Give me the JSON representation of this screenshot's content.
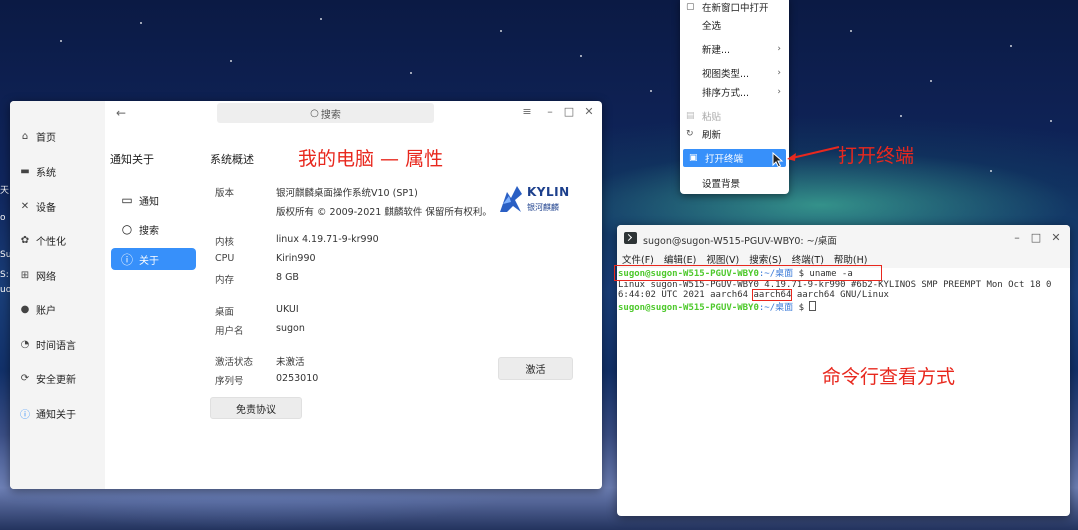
{
  "desktop": {
    "left_edge": [
      "天",
      "o",
      "Suo",
      "S:",
      "uo"
    ]
  },
  "settings": {
    "search_placeholder": "搜索",
    "sidebar": [
      {
        "icon": "home-icon",
        "label": "首页"
      },
      {
        "icon": "monitor-icon",
        "label": "系统"
      },
      {
        "icon": "tools-icon",
        "label": "设备"
      },
      {
        "icon": "palette-icon",
        "label": "个性化"
      },
      {
        "icon": "network-icon",
        "label": "网络"
      },
      {
        "icon": "user-icon",
        "label": "账户"
      },
      {
        "icon": "clock-icon",
        "label": "时间语言"
      },
      {
        "icon": "update-icon",
        "label": "安全更新"
      },
      {
        "icon": "info-icon",
        "label": "通知关于"
      }
    ],
    "panel_title": "通知关于",
    "sub_items": [
      {
        "icon": "notification-icon",
        "label": "通知"
      },
      {
        "icon": "search-icon",
        "label": "搜索"
      },
      {
        "icon": "info-icon",
        "label": "关于"
      }
    ],
    "section_title": "系统概述",
    "overlay_title": "我的电脑 — 属性",
    "info": {
      "version_label": "版本",
      "version_value": "银河麒麟桌面操作系统V10 (SP1)",
      "copyright": "版权所有 © 2009-2021 麒麟软件 保留所有权利。",
      "kernel_label": "内核",
      "kernel_value": "linux 4.19.71-9-kr990",
      "cpu_label": "CPU",
      "cpu_value": "Kirin990",
      "memory_label": "内存",
      "memory_value": "8 GB",
      "desktop_label": "桌面",
      "desktop_value": "UKUI",
      "username_label": "用户名",
      "username_value": "sugon",
      "activation_label": "激活状态",
      "activation_value": "未激活",
      "serial_label": "序列号",
      "serial_value": "0253010"
    },
    "logo_text": "KYLIN",
    "logo_text_cn": "银河麒麟",
    "activate_button": "激活",
    "disclaimer_button": "免责协议"
  },
  "context_menu": {
    "items": [
      {
        "icon": "window-icon",
        "label": "在新窗口中打开",
        "arrow": false,
        "disabled": false
      },
      {
        "icon": "",
        "label": "全选",
        "arrow": false,
        "disabled": false
      },
      {
        "icon": "",
        "label": "新建...",
        "arrow": true,
        "disabled": false
      },
      {
        "icon": "",
        "label": "视图类型...",
        "arrow": true,
        "disabled": false
      },
      {
        "icon": "",
        "label": "排序方式...",
        "arrow": true,
        "disabled": false
      },
      {
        "icon": "paste-icon",
        "label": "粘贴",
        "arrow": false,
        "disabled": true
      },
      {
        "icon": "refresh-icon",
        "label": "刷新",
        "arrow": false,
        "disabled": false
      },
      {
        "icon": "terminal-icon",
        "label": "打开终端",
        "arrow": false,
        "disabled": false,
        "highlight": true
      },
      {
        "icon": "",
        "label": "设置背景",
        "arrow": false,
        "disabled": false
      }
    ],
    "annotation": "打开终端"
  },
  "terminal": {
    "title": "sugon@sugon-W515-PGUV-WBY0: ~/桌面",
    "menus": [
      "文件(F)",
      "编辑(E)",
      "视图(V)",
      "搜索(S)",
      "终端(T)",
      "帮助(H)"
    ],
    "prompt_user": "sugon@sugon-W515-PGUV-WBY0",
    "prompt_path": ":~/桌面",
    "prompt_sep": "$",
    "command": "uname -a",
    "output_line1": "Linux sugon-W515-PGUV-WBY0 4.19.71-9-kr990 #6b2-KYLINOS SMP PREEMPT Mon Oct 18 0",
    "output_line2_pre": "6:44:02 UTC 2021 aarch64 ",
    "output_line2_boxed": "aarch64",
    "output_line2_post": " aarch64 GNU/Linux",
    "annotation": "命令行查看方式"
  }
}
